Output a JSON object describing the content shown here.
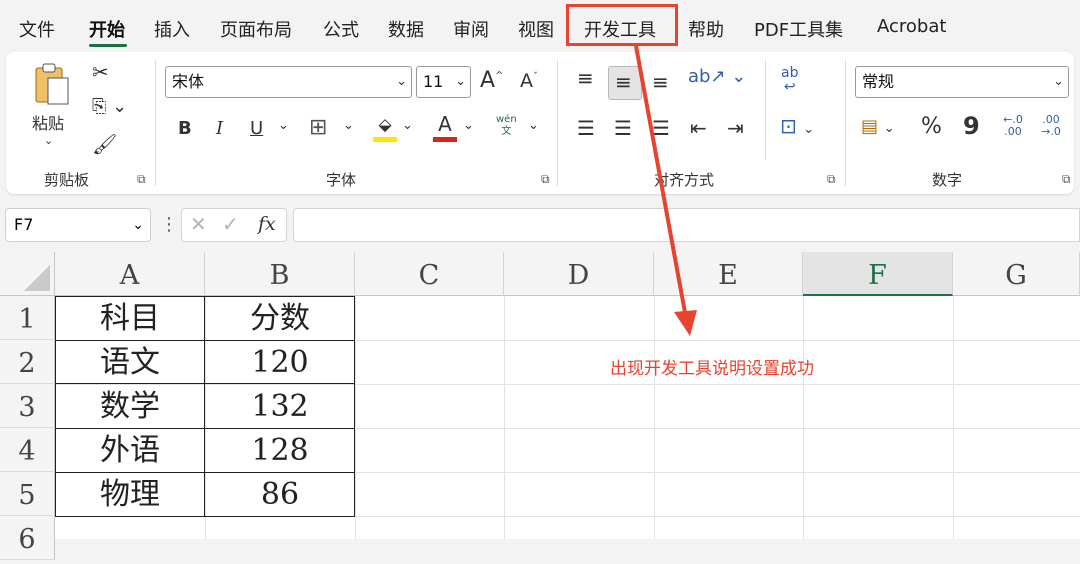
{
  "tabs": [
    "文件",
    "开始",
    "插入",
    "页面布局",
    "公式",
    "数据",
    "审阅",
    "视图",
    "开发工具",
    "帮助",
    "PDF工具集",
    "Acrobat"
  ],
  "colors": {
    "accent": "#1e7145",
    "annotation": "#e8432f"
  },
  "clipboard": {
    "paste_label": "粘贴",
    "group_label": "剪贴板"
  },
  "font": {
    "name": "宋体",
    "size": "11",
    "group_label": "字体",
    "phonetic_top": "wén",
    "phonetic_bottom": "文",
    "bold": "B",
    "italic": "I",
    "underline": "U",
    "grow": "A",
    "shrink": "A",
    "color_a": "A"
  },
  "alignment": {
    "group_label": "对齐方式"
  },
  "number": {
    "format": "常规",
    "group_label": "数字",
    "percent": "%",
    "comma": "9",
    "inc_decimal": "←.0 .00",
    "dec_decimal": ".00 →.0"
  },
  "formula_bar": {
    "name_box": "F7",
    "fx": "fx",
    "value": ""
  },
  "sheet": {
    "columns": [
      "A",
      "B",
      "C",
      "D",
      "E",
      "F",
      "G"
    ],
    "rows": [
      "1",
      "2",
      "3",
      "4",
      "5",
      "6"
    ],
    "cells": [
      [
        "科目",
        "分数"
      ],
      [
        "语文",
        "120"
      ],
      [
        "数学",
        "132"
      ],
      [
        "外语",
        "128"
      ],
      [
        "物理",
        "86"
      ]
    ]
  },
  "annotation": {
    "text": "出现开发工具说明设置成功",
    "target_tab": "开发工具"
  }
}
